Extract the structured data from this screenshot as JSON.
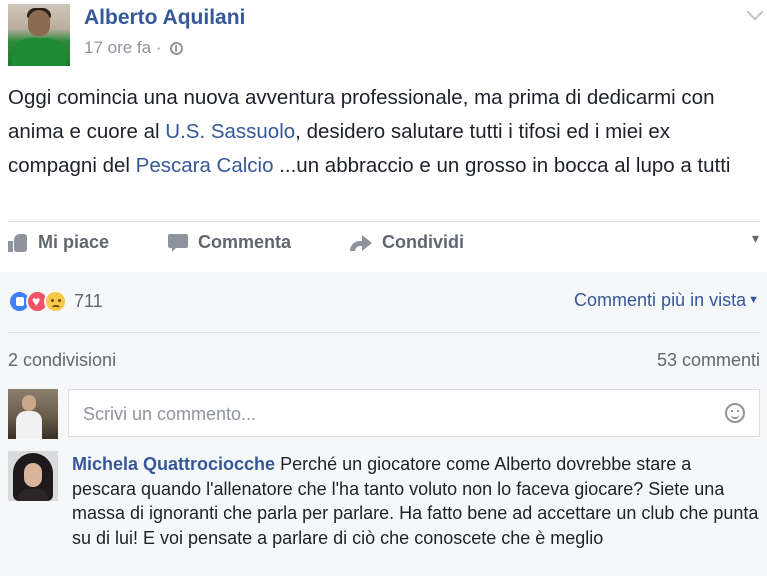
{
  "post": {
    "author": "Alberto Aquilani",
    "timestamp": "17 ore fa",
    "separator": " · ",
    "text_parts": [
      "Oggi comincia una nuova avventura professionale, ma prima di dedicarmi con anima e cuore al ",
      "U.S. Sassuolo",
      ", desidero salutare tutti i tifosi ed i miei ex compagni del ",
      "Pescara Calcio",
      " ...un abbraccio e un grosso in bocca al lupo a tutti"
    ]
  },
  "actions": {
    "like": "Mi piace",
    "comment": "Commenta",
    "share": "Condividi"
  },
  "feedback": {
    "reaction_types": [
      "like",
      "love",
      "sad"
    ],
    "reaction_count": "711",
    "sort_label": "Commenti più in vista",
    "shares": "2 condivisioni",
    "comments": "53 commenti"
  },
  "composer": {
    "placeholder": "Scrivi un commento..."
  },
  "comment": {
    "author": "Michela Quattrociocche",
    "text": " Perché un giocatore come Alberto dovrebbe stare a pescara quando l'allenatore che l'ha tanto voluto non lo faceva giocare? Siete una massa di ignoranti che parla per parlare. Ha fatto bene ad accettare un club che punta su di lui! E voi pensate a parlare di ciò che conoscete che è meglio"
  },
  "colors": {
    "link": "#365899",
    "text": "#1d2129",
    "muted": "#606770",
    "feedback_bg": "#f6f7f9"
  }
}
